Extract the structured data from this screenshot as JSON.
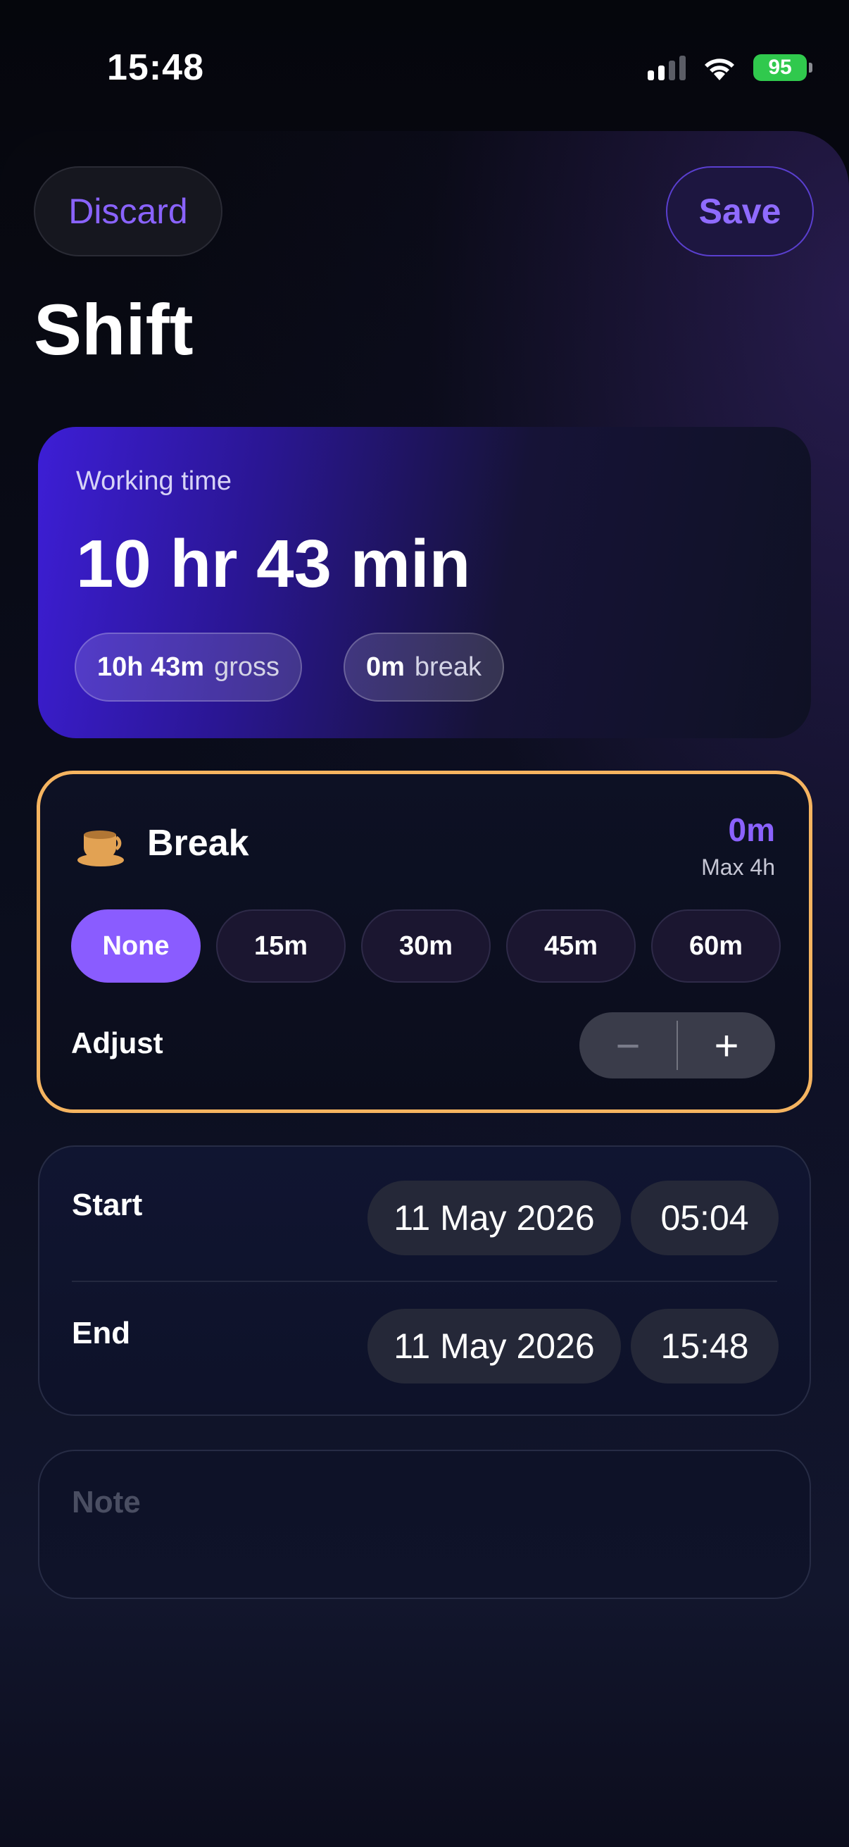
{
  "status_bar": {
    "time": "15:48",
    "battery": "95"
  },
  "header": {
    "discard_label": "Discard",
    "save_label": "Save",
    "title": "Shift"
  },
  "working_time": {
    "label": "Working time",
    "value": "10 hr 43 min",
    "gross_value": "10h 43m",
    "gross_unit": "gross",
    "break_value": "0m",
    "break_unit": "break"
  },
  "break": {
    "title": "Break",
    "amount": "0m",
    "max": "Max 4h",
    "options": [
      "None",
      "15m",
      "30m",
      "45m",
      "60m"
    ],
    "selected": "None",
    "adjust_label": "Adjust",
    "minus": "−",
    "plus": "+"
  },
  "times": {
    "start_label": "Start",
    "start_date": "11 May 2026",
    "start_time": "05:04",
    "end_label": "End",
    "end_date": "11 May 2026",
    "end_time": "15:48"
  },
  "note": {
    "placeholder": "Note"
  },
  "colors": {
    "accent": "#8a5cff",
    "highlight_border": "#f5b460",
    "battery": "#30c94d"
  }
}
